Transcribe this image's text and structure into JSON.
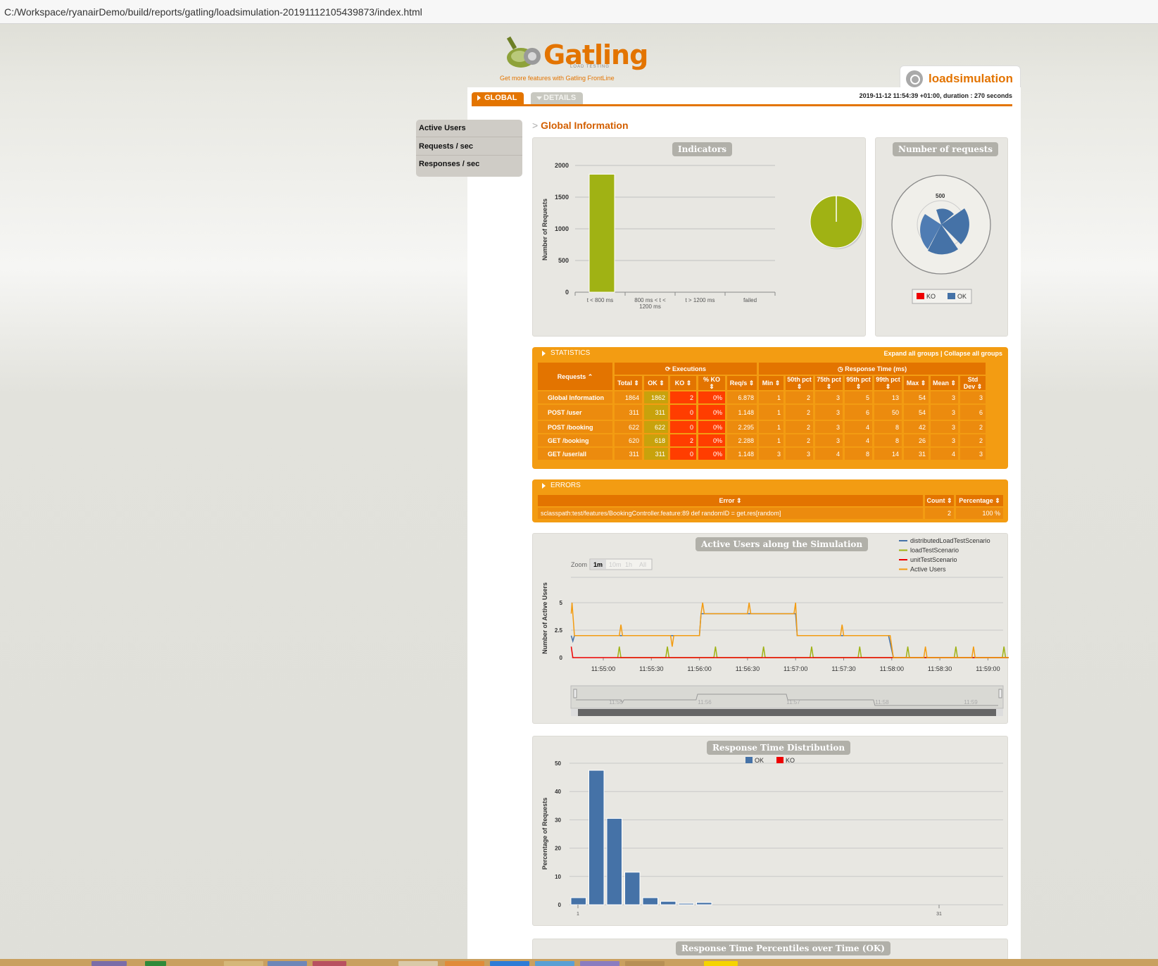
{
  "url": "C:/Workspace/ryanairDemo/build/reports/gatling/loadsimulation-20191112105439873/index.html",
  "logo": {
    "word": "Gatling",
    "sub": "LOAD TESTING",
    "tagline": "Get more features with Gatling FrontLine"
  },
  "simulation_name": "loadsimulation",
  "tabs": {
    "global": "GLOBAL",
    "details": "DETAILS"
  },
  "run_info": "2019-11-12 11:54:39 +01:00, duration : 270 seconds",
  "sidebar": {
    "items": [
      {
        "label": "Active Users"
      },
      {
        "label": "Requests / sec"
      },
      {
        "label": "Responses / sec"
      }
    ]
  },
  "global_title": "Global Information",
  "indicators": {
    "title": "Indicators",
    "ylabel": "Number of Requests",
    "yticks": [
      "2000",
      "1500",
      "1000",
      "500",
      "0"
    ],
    "categories": [
      "t < 800 ms",
      "800 ms < t < 1200 ms",
      "t > 1200 ms",
      "failed"
    ],
    "cat_line2": "1200 ms",
    "values": [
      1862,
      0,
      0,
      2
    ],
    "colors": {
      "bar": "#a0b214",
      "pie": "#a0b214",
      "failed": "#f00"
    }
  },
  "num_requests": {
    "title": "Number of requests",
    "tick": "500",
    "legend": [
      "KO",
      "OK"
    ],
    "colors": {
      "KO": "#e00",
      "OK": "#4572a7"
    }
  },
  "statistics": {
    "title": "STATISTICS",
    "links": "Expand all groups | Collapse all groups",
    "group_executions": "Executions",
    "group_response": "Response Time (ms)",
    "columns": [
      "Requests ⌃",
      "Total ⇕",
      "OK ⇕",
      "KO ⇕",
      "% KO ⇕",
      "Req/s ⇕",
      "Min ⇕",
      "50th pct ⇕",
      "75th pct ⇕",
      "95th pct ⇕",
      "99th pct ⇕",
      "Max ⇕",
      "Mean ⇕",
      "Std Dev ⇕"
    ],
    "rows": [
      {
        "name": "Global Information",
        "total": "1864",
        "ok": "1862",
        "ko": "2",
        "pko": "0%",
        "rps": "6.878",
        "min": "1",
        "p50": "2",
        "p75": "3",
        "p95": "5",
        "p99": "13",
        "max": "54",
        "mean": "3",
        "std": "3"
      },
      {
        "name": "POST /user",
        "total": "311",
        "ok": "311",
        "ko": "0",
        "pko": "0%",
        "rps": "1.148",
        "min": "1",
        "p50": "2",
        "p75": "3",
        "p95": "6",
        "p99": "50",
        "max": "54",
        "mean": "3",
        "std": "6"
      },
      {
        "name": "POST /booking",
        "total": "622",
        "ok": "622",
        "ko": "0",
        "pko": "0%",
        "rps": "2.295",
        "min": "1",
        "p50": "2",
        "p75": "3",
        "p95": "4",
        "p99": "8",
        "max": "42",
        "mean": "3",
        "std": "2"
      },
      {
        "name": "GET /booking",
        "total": "620",
        "ok": "618",
        "ko": "2",
        "pko": "0%",
        "rps": "2.288",
        "min": "1",
        "p50": "2",
        "p75": "3",
        "p95": "4",
        "p99": "8",
        "max": "26",
        "mean": "3",
        "std": "2"
      },
      {
        "name": "GET /user/all",
        "total": "311",
        "ok": "311",
        "ko": "0",
        "pko": "0%",
        "rps": "1.148",
        "min": "3",
        "p50": "3",
        "p75": "4",
        "p95": "8",
        "p99": "14",
        "max": "31",
        "mean": "4",
        "std": "3"
      }
    ]
  },
  "errors": {
    "title": "ERRORS",
    "columns": [
      "Error ⇕",
      "Count ⇕",
      "Percentage ⇕"
    ],
    "rows": [
      {
        "error": "sclasspath:test/features/BookingController.feature:89 def randomID = get.res[random]",
        "count": "2",
        "pct": "100 %"
      }
    ]
  },
  "active_users": {
    "title": "Active Users along the Simulation",
    "zoom_label": "Zoom",
    "zoom_buttons": [
      "1m",
      "10m",
      "1h",
      "All"
    ],
    "ylabel": "Number of Active Users",
    "yticks": [
      "5",
      "2.5",
      "0"
    ],
    "xticks": [
      "11:55:00",
      "11:55:30",
      "11:56:00",
      "11:56:30",
      "11:57:00",
      "11:57:30",
      "11:58:00",
      "11:58:30",
      "11:59:00"
    ],
    "nav_ticks": [
      "11:55",
      "11:56",
      "11:57",
      "11:58",
      "11:59"
    ],
    "legend": [
      {
        "name": "distributedLoadTestScenario",
        "color": "#4572a7"
      },
      {
        "name": "loadTestScenario",
        "color": "#a0b214"
      },
      {
        "name": "unitTestScenario",
        "color": "#e00"
      },
      {
        "name": "Active Users",
        "color": "#f39c12"
      }
    ]
  },
  "response_dist": {
    "title": "Response Time Distribution",
    "legend": [
      "OK",
      "KO"
    ],
    "ylabel": "Percentage of Requests",
    "yticks": [
      "50",
      "40",
      "30",
      "20",
      "10",
      "0"
    ],
    "xticks": [
      "1",
      "31"
    ],
    "values": [
      2.5,
      47.5,
      30.5,
      11.5,
      2.5,
      1.2,
      0.5,
      0.8
    ],
    "colors": {
      "OK": "#4572a7",
      "KO": "#e00"
    }
  },
  "percentiles": {
    "title": "Response Time Percentiles over Time (OK)"
  }
}
